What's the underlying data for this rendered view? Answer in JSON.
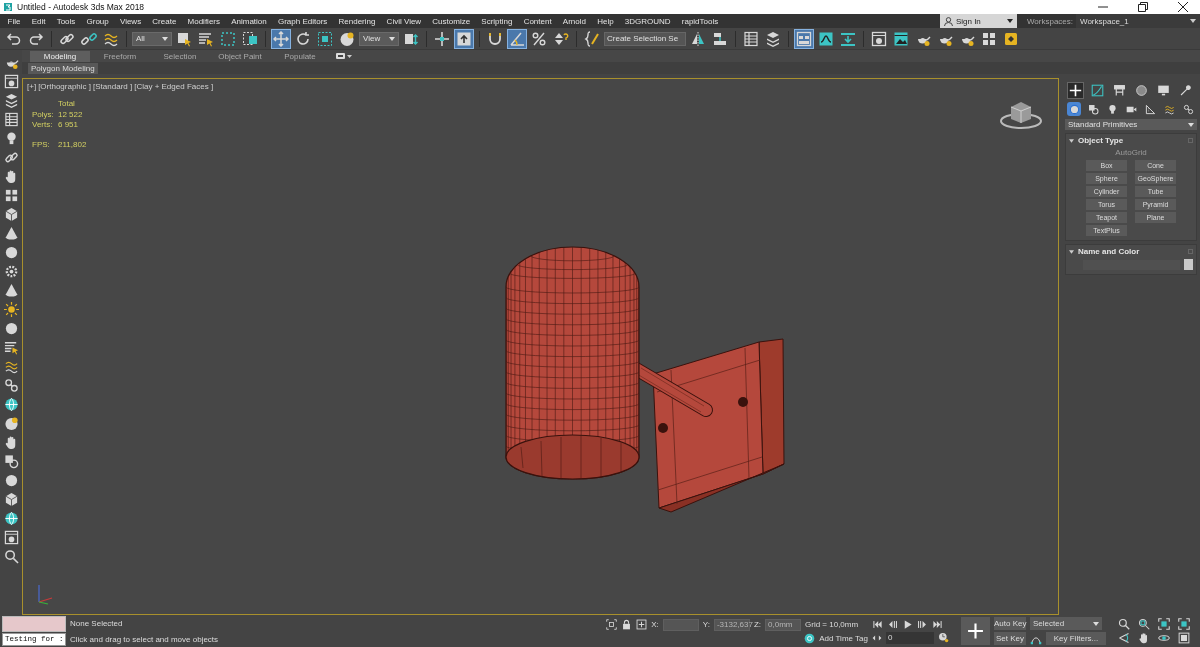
{
  "window": {
    "title": "Untitled - Autodesk 3ds Max 2018"
  },
  "menu": {
    "items": [
      "File",
      "Edit",
      "Tools",
      "Group",
      "Views",
      "Create",
      "Modifiers",
      "Animation",
      "Graph Editors",
      "Rendering",
      "Civil View",
      "Customize",
      "Scripting",
      "Content",
      "Arnold",
      "Help",
      "3DGROUND",
      "rapidTools"
    ],
    "sign_in": "Sign In",
    "workspaces_label": "Workspaces:",
    "workspace": "Workspace_1"
  },
  "toolbar": {
    "groups": [
      [
        {
          "kind": "button",
          "selected": false
        },
        {
          "kind": "button",
          "selected": false
        }
      ],
      [
        {
          "kind": "button",
          "selected": false
        },
        {
          "kind": "button",
          "selected": false
        },
        {
          "kind": "button",
          "selected": false
        }
      ],
      [
        {
          "kind": "dropdown",
          "value": "All"
        },
        {
          "kind": "button",
          "selected": false
        },
        {
          "kind": "button",
          "selected": false
        },
        {
          "kind": "button",
          "selected": false
        },
        {
          "kind": "button",
          "selected": false
        }
      ],
      [
        {
          "kind": "button",
          "selected": true
        },
        {
          "kind": "button",
          "selected": false
        },
        {
          "kind": "button",
          "selected": false
        },
        {
          "kind": "button",
          "selected": false
        },
        {
          "kind": "dropdown",
          "value": "View"
        },
        {
          "kind": "button",
          "selected": false
        }
      ],
      [
        {
          "kind": "button",
          "selected": false
        },
        {
          "kind": "button",
          "selected": true
        }
      ],
      [
        {
          "kind": "button",
          "selected": false
        },
        {
          "kind": "button",
          "selected": true
        },
        {
          "kind": "button",
          "selected": false
        },
        {
          "kind": "button",
          "selected": false
        }
      ],
      [
        {
          "kind": "button",
          "selected": false
        },
        {
          "kind": "field",
          "value": "Create Selection Se"
        },
        {
          "kind": "button",
          "selected": false
        },
        {
          "kind": "button",
          "selected": false
        }
      ],
      [
        {
          "kind": "button",
          "selected": false
        },
        {
          "kind": "button",
          "selected": false
        }
      ],
      [
        {
          "kind": "button",
          "selected": true
        },
        {
          "kind": "button",
          "selected": false
        },
        {
          "kind": "button",
          "selected": false
        }
      ],
      [
        {
          "kind": "button",
          "selected": false
        },
        {
          "kind": "button",
          "selected": false
        },
        {
          "kind": "button",
          "selected": false
        },
        {
          "kind": "button",
          "selected": false
        },
        {
          "kind": "button",
          "selected": false
        },
        {
          "kind": "button",
          "selected": false
        },
        {
          "kind": "button",
          "selected": false
        }
      ]
    ]
  },
  "ribbon": {
    "tabs": [
      {
        "label": "Modeling",
        "selected": true
      },
      {
        "label": "Freeform",
        "selected": false
      },
      {
        "label": "Selection",
        "selected": false
      },
      {
        "label": "Object Paint",
        "selected": false
      },
      {
        "label": "Populate",
        "selected": false
      }
    ],
    "panel": "Polygon Modeling"
  },
  "viewport": {
    "labels": [
      "[+]",
      "[Orthographic ]",
      "[Standard ]",
      "[Clay + Edged Faces ]"
    ],
    "stats": {
      "header": "Total",
      "rows": [
        {
          "label": "Polys:",
          "value": "12 522"
        },
        {
          "label": "Verts:",
          "value": "6 951"
        }
      ],
      "fps_label": "FPS:",
      "fps": "211,802"
    }
  },
  "command_panel": {
    "tabs": [
      {
        "selected": true
      },
      {
        "selected": false
      },
      {
        "selected": false
      },
      {
        "selected": false
      },
      {
        "selected": false
      },
      {
        "selected": false
      }
    ],
    "categories": [
      {
        "selected": true
      },
      {
        "selected": false
      },
      {
        "selected": false
      },
      {
        "selected": false
      },
      {
        "selected": false
      },
      {
        "selected": false
      },
      {
        "selected": false
      }
    ],
    "dropdown": "Standard Primitives",
    "object_type": {
      "title": "Object Type",
      "autogrid": {
        "label": "AutoGrid",
        "disabled": true
      },
      "buttons": [
        "Box",
        "Cone",
        "Sphere",
        "GeoSphere",
        "Cylinder",
        "Tube",
        "Torus",
        "Pyramid",
        "Teapot",
        "Plane",
        "TextPlus"
      ]
    },
    "name_and_color": {
      "title": "Name and Color"
    }
  },
  "status": {
    "listener": "Testing for :",
    "selection": "None Selected",
    "prompt": "Click and drag to select and move objects",
    "x_label": "X:",
    "y_label": "Y:",
    "y_value": "-3132,637",
    "z_label": "Z:",
    "z_value": "0,0mm",
    "grid": "Grid = 10,0mm",
    "time_tag": "Add Time Tag",
    "frame": "0",
    "auto_key": "Auto Key",
    "key_mode": "Selected",
    "set_key": "Set Key",
    "key_filters": "Key Filters..."
  }
}
